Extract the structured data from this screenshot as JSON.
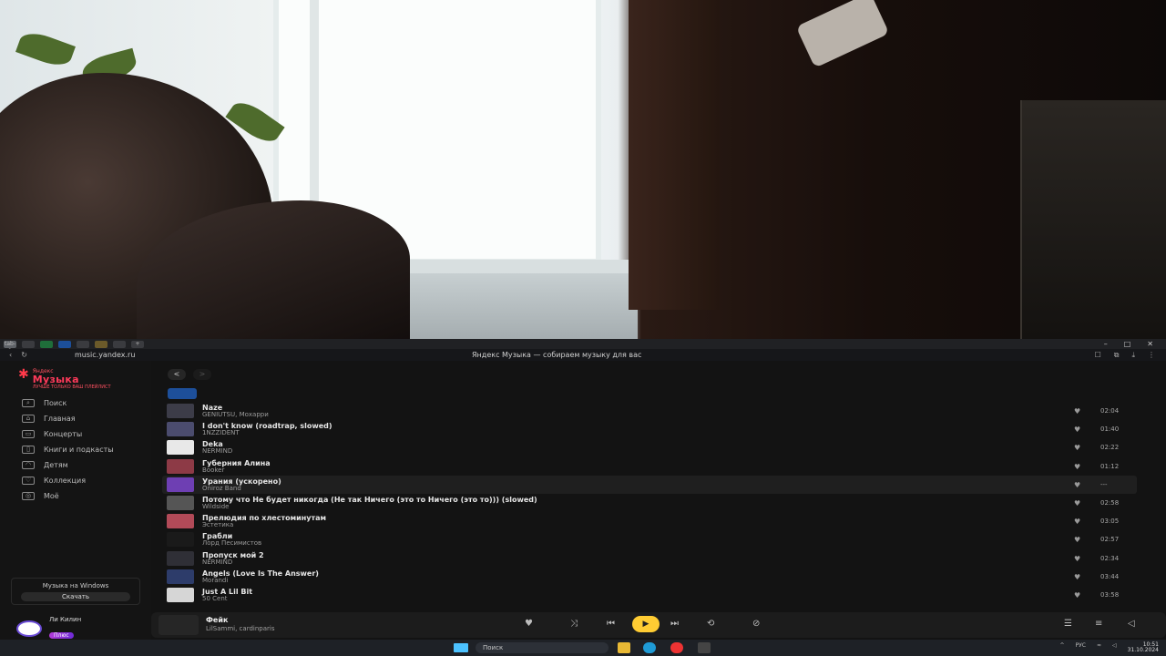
{
  "browser": {
    "tabs": [
      "tab-1",
      "tab-2",
      "tab-3",
      "tab-4",
      "tab-5",
      "tab-6",
      "tab-7"
    ],
    "url": "music.yandex.ru",
    "title": "Яндекс Музыка — собираем музыку для вас",
    "new_tab": "+"
  },
  "sidebar": {
    "logo": {
      "top": "Яндекс",
      "main": "Музыка",
      "sub": "ЛУЧШЕ ТОЛЬКО ВАШ ПЛЕЙЛИСТ"
    },
    "items": [
      {
        "label": "Поиск",
        "icon": "search-icon"
      },
      {
        "label": "Главная",
        "icon": "home-icon"
      },
      {
        "label": "Концерты",
        "icon": "ticket-icon"
      },
      {
        "label": "Книги и подкасты",
        "icon": "book-icon"
      },
      {
        "label": "Детям",
        "icon": "kids-icon"
      },
      {
        "label": "Коллекция",
        "icon": "collection-icon"
      },
      {
        "label": "Моё",
        "icon": "user-icon"
      }
    ],
    "promo": {
      "text": "Музыка на Windows",
      "button": "Скачать"
    },
    "user": {
      "name": "Ли Килин",
      "badge": "Плюс"
    }
  },
  "nav": {
    "back": "<",
    "forward": ">"
  },
  "tracks": [
    {
      "title": "Naze",
      "artist": "GENIUTSU, Мохарри",
      "duration": "02:04",
      "cover": "#3c3c48"
    },
    {
      "title": "I don't know (roadtrap, slowed)",
      "artist": "1NZZIDENT",
      "duration": "01:40",
      "cover": "#4b4c6e"
    },
    {
      "title": "Deka",
      "artist": "NERMIND",
      "duration": "02:22",
      "cover": "#e8e8e8"
    },
    {
      "title": "Губерния Алина",
      "artist": "Booker",
      "duration": "01:12",
      "cover": "#8d3a46"
    },
    {
      "title": "Урания (ускорено)",
      "artist": "Oniroz Band",
      "duration": "---",
      "cover": "#6e3fb3"
    },
    {
      "title": "Потому что Не будет никогда (Не так Ничего (это то Ничего (это то))) (slowed)",
      "artist": "Wildside",
      "duration": "02:58",
      "cover": "#555555"
    },
    {
      "title": "Прелюдия по хлестоминутам",
      "artist": "Эстетика",
      "duration": "03:05",
      "cover": "#b24a58"
    },
    {
      "title": "Грабли",
      "artist": "Лорд Песимистов",
      "duration": "02:57",
      "cover": "#1a1a1a"
    },
    {
      "title": "Пропуск мой 2",
      "artist": "NERMIND",
      "duration": "02:34",
      "cover": "#2f2f36"
    },
    {
      "title": "Angels (Love Is The Answer)",
      "artist": "Morandi",
      "duration": "03:44",
      "cover": "#2d3c6a"
    },
    {
      "title": "Just A Lil Bit",
      "artist": "50 Cent",
      "duration": "03:58",
      "cover": "#d6d6d6"
    }
  ],
  "player": {
    "title": "Фейк",
    "artist": "LilSammi, cardinparis"
  },
  "taskbar": {
    "search": "Поиск",
    "lang": "РУС",
    "time": "10:51",
    "date": "31.10.2024"
  }
}
